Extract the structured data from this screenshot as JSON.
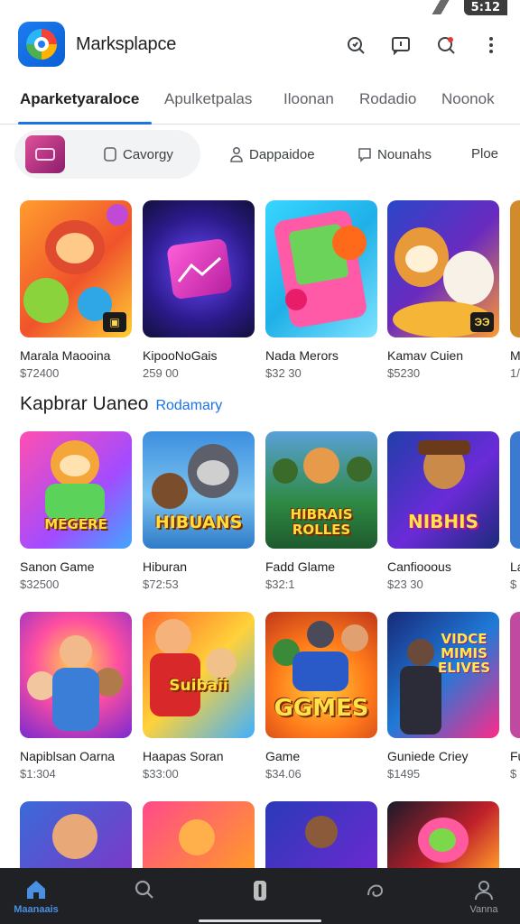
{
  "status_bar": {
    "time": "5:12"
  },
  "app_bar": {
    "title": "Marksplapce"
  },
  "tabs": [
    {
      "label": "Aparketyaraloce",
      "active": true
    },
    {
      "label": "Apulketpalas",
      "active": false
    },
    {
      "label": "Iloonan",
      "active": false
    },
    {
      "label": "Rodadio",
      "active": false
    },
    {
      "label": "Noonok",
      "active": false
    }
  ],
  "chips": [
    {
      "label": "Cavorgy",
      "icon": "tag-icon"
    },
    {
      "label": "Dappaidoe",
      "icon": "person-icon"
    },
    {
      "label": "Nounahs",
      "icon": "chat-icon"
    },
    {
      "label": "Ploe",
      "icon": ""
    }
  ],
  "featured": [
    {
      "title": "Marala Maooina",
      "price": "$72400"
    },
    {
      "title": "KipooNoGais",
      "price": "259 00"
    },
    {
      "title": "Nada Merors",
      "price": "$32 30"
    },
    {
      "title": "Kamav Cuien",
      "price": "$5230"
    },
    {
      "title": "M",
      "price": "1/"
    }
  ],
  "section": {
    "title": "Kapbrar Uaneo",
    "link": "Rodamary"
  },
  "row2": [
    {
      "title": "Sanon Game",
      "price": "$32500",
      "art_text": "MEGERE"
    },
    {
      "title": "Hiburan",
      "price": "$72:53",
      "art_text": "HIBUANS"
    },
    {
      "title": "Fadd Glame",
      "price": "$32:1",
      "art_text": "HIBRAIS ROLLES"
    },
    {
      "title": "Canfiooous",
      "price": "$23 30",
      "art_text": "NIBHIS"
    },
    {
      "title": "La",
      "price": "$"
    }
  ],
  "row3": [
    {
      "title": "Napiblsan Oarna",
      "price": "$1:304",
      "art_text": ""
    },
    {
      "title": "Haapas Soran",
      "price": "$33:00",
      "art_text": "Suibaii"
    },
    {
      "title": "Game",
      "price": "$34.06",
      "art_text": "GGMES"
    },
    {
      "title": "Guniede Criey",
      "price": "$1495",
      "art_text": "VIDCE MIMIS ELIVES"
    },
    {
      "title": "Fu",
      "price": "$"
    }
  ],
  "bottom_nav": [
    {
      "label": "Maanaais",
      "icon": "home-icon",
      "active": true
    },
    {
      "label": "",
      "icon": "search-icon",
      "active": false
    },
    {
      "label": "",
      "icon": "apps-icon",
      "active": false
    },
    {
      "label": "",
      "icon": "chat-icon",
      "active": false
    },
    {
      "label": "Vanna",
      "icon": "account-icon",
      "active": false
    }
  ],
  "colors": {
    "accent": "#1a73e8",
    "nav_bg": "#1f2125",
    "nav_active": "#4a90e2"
  }
}
